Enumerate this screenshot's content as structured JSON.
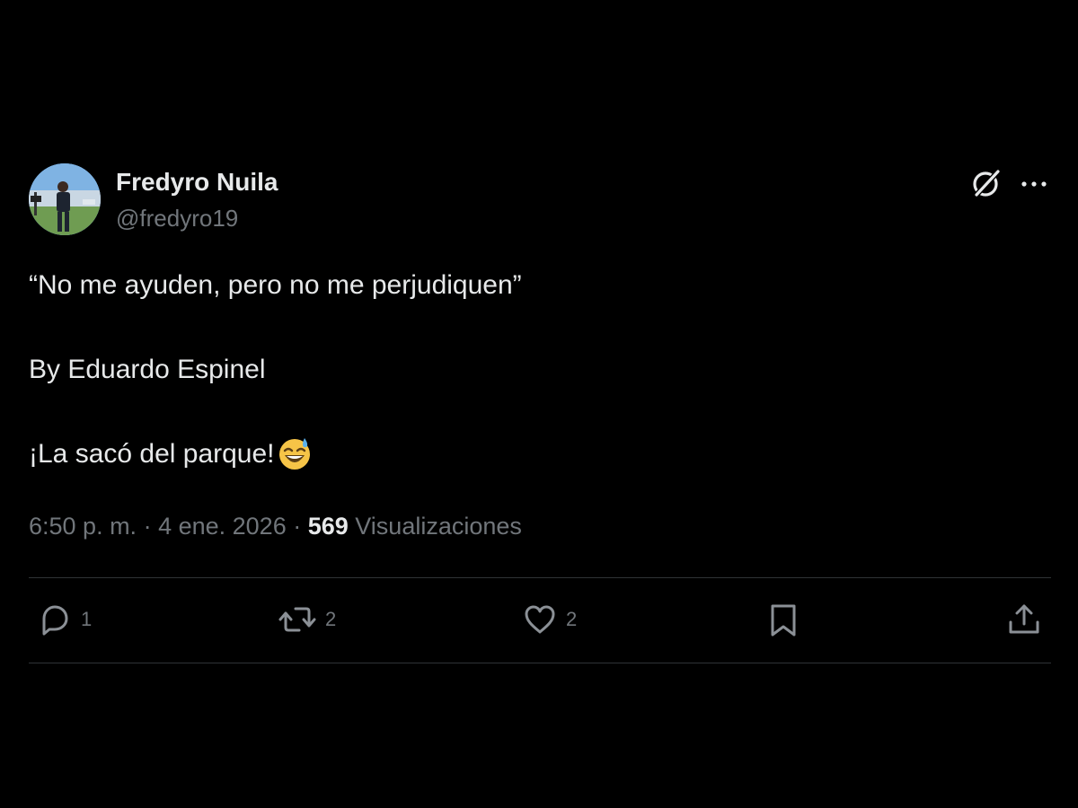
{
  "author": {
    "display_name": "Fredyro Nuila",
    "handle": "@fredyro19"
  },
  "tweet": {
    "line1": "“No me ayuden, pero no me perjudiquen”",
    "line2": "By Eduardo Espinel",
    "line3": "¡La sacó del parque!",
    "emoji": "grinning-face-with-sweat-emoji"
  },
  "meta": {
    "time": "6:50 p. m.",
    "separator1": " · ",
    "date": "4 ene. 2026",
    "separator2": " · ",
    "views_count": "569",
    "views_label": " Visualizaciones"
  },
  "actions": {
    "reply_count": "1",
    "retweet_count": "2",
    "like_count": "2"
  },
  "icons": {
    "grok": "grok-icon",
    "more": "more-dots-icon",
    "reply": "reply-icon",
    "retweet": "retweet-icon",
    "like": "heart-icon",
    "bookmark": "bookmark-icon",
    "share": "share-icon"
  },
  "colors": {
    "background": "#000000",
    "text_primary": "#e7e9ea",
    "text_secondary": "#71767b",
    "divider": "#2f3336"
  }
}
